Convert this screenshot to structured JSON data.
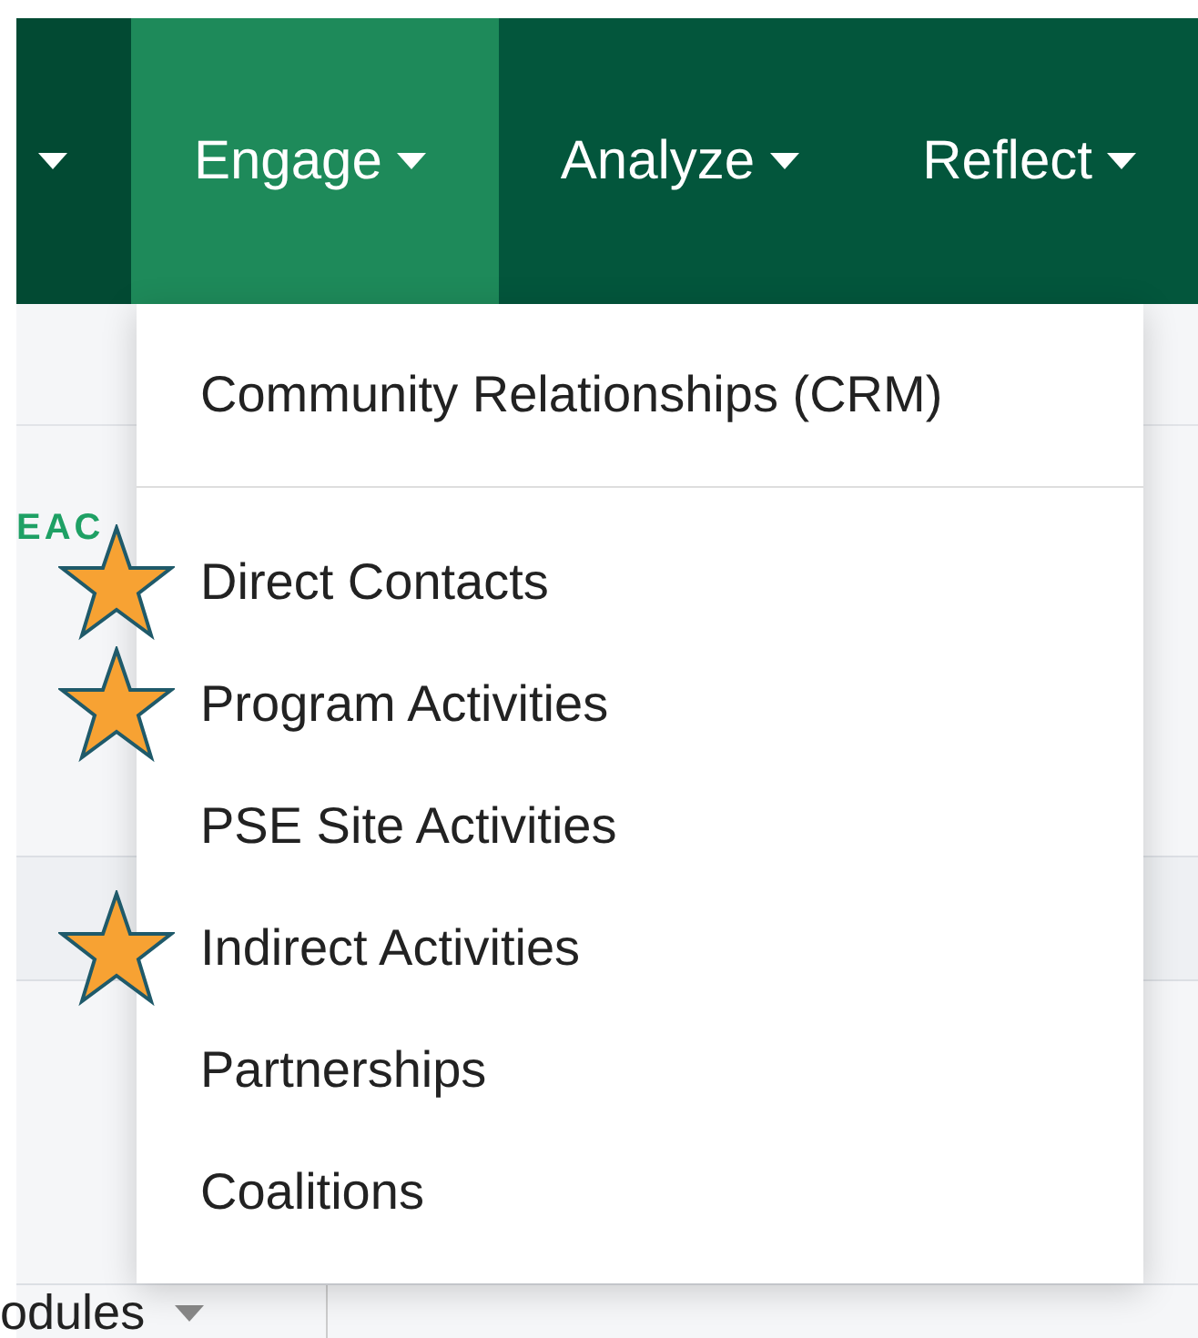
{
  "nav": {
    "items": [
      {
        "selected": false
      },
      {
        "label": "Engage",
        "selected": true
      },
      {
        "label": "Analyze",
        "selected": false
      },
      {
        "label": "Reflect",
        "selected": false
      }
    ]
  },
  "page": {
    "section_label": "EAC",
    "modules_label": "odules"
  },
  "dropdown": {
    "header_item": "Community Relationships (CRM)",
    "items": [
      {
        "label": "Direct Contacts",
        "starred": true
      },
      {
        "label": "Program Activities",
        "starred": true
      },
      {
        "label": "PSE Site Activities",
        "starred": false
      },
      {
        "label": "Indirect Activities",
        "starred": true
      },
      {
        "label": "Partnerships",
        "starred": false
      },
      {
        "label": "Coalitions",
        "starred": false
      }
    ]
  }
}
